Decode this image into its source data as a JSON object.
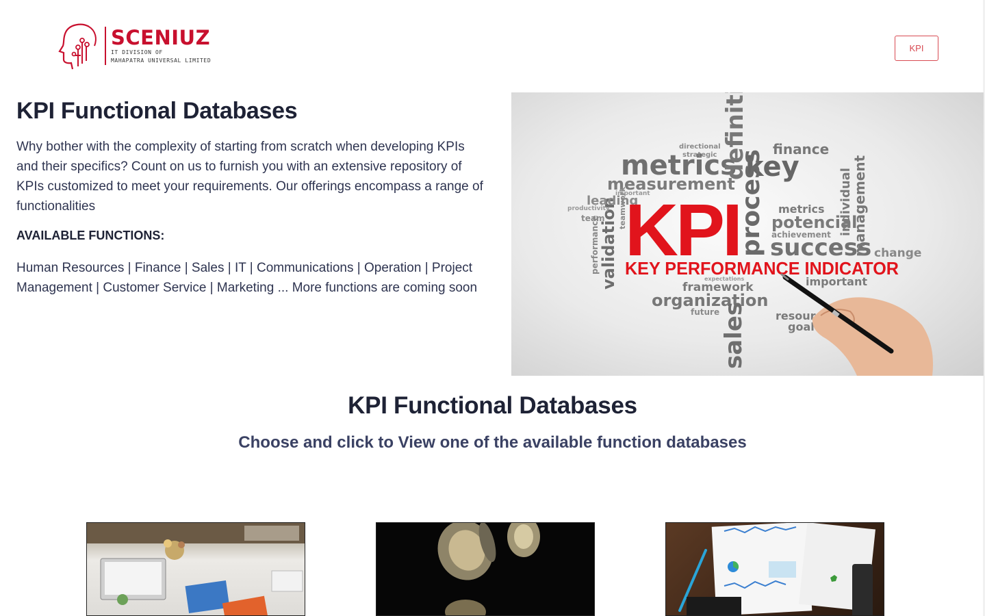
{
  "header": {
    "logo": {
      "brand": "SCENIUZ",
      "subtitle_line1": "IT DIVISION OF",
      "subtitle_line2": "MAHAPATRA UNIVERSAL LIMITED",
      "icon": "head-neuron-icon"
    },
    "nav_button_label": "KPI"
  },
  "hero": {
    "title": "KPI Functional Databases",
    "description": "Why bother with the complexity of starting from scratch when developing KPIs and their specifics? Count on us to furnish you with an extensive repository of KPIs customized to meet your requirements. Our offerings encompass a range of functionalities",
    "available_label": "AVAILABLE FUNCTIONS:",
    "functions_text": "Human Resources | Finance | Sales | IT | Communications | Operation | Project Management | Customer Service | Marketing ... More functions are coming soon",
    "image": {
      "kpi": "KPI",
      "tagline": "KEY PERFORMANCE INDICATOR",
      "words_large": [
        "metrics",
        "measurement",
        "key",
        "definition",
        "process",
        "success",
        "potencial",
        "organization",
        "sales",
        "validation",
        "finance",
        "management",
        "leading",
        "change"
      ],
      "words_small": [
        "directional",
        "strategic",
        "important",
        "productivity",
        "team",
        "framework",
        "future",
        "achievement",
        "metrics",
        "individual",
        "teamwork",
        "performance",
        "expectations",
        "resources",
        "goal",
        "important"
      ]
    }
  },
  "section": {
    "title": "KPI Functional Databases",
    "subtitle": "Choose and click to View one of the available function databases"
  },
  "cards": [
    {
      "name": "human-resources",
      "image": "office-desk-photo"
    },
    {
      "name": "finance",
      "image": "falling-coins-photo"
    },
    {
      "name": "sales",
      "image": "report-charts-photo"
    }
  ],
  "colors": {
    "brand_red": "#c8102e",
    "button_red": "#d84a52",
    "heading": "#1e2235",
    "body_text": "#2e3450",
    "subheading": "#3a4163"
  }
}
